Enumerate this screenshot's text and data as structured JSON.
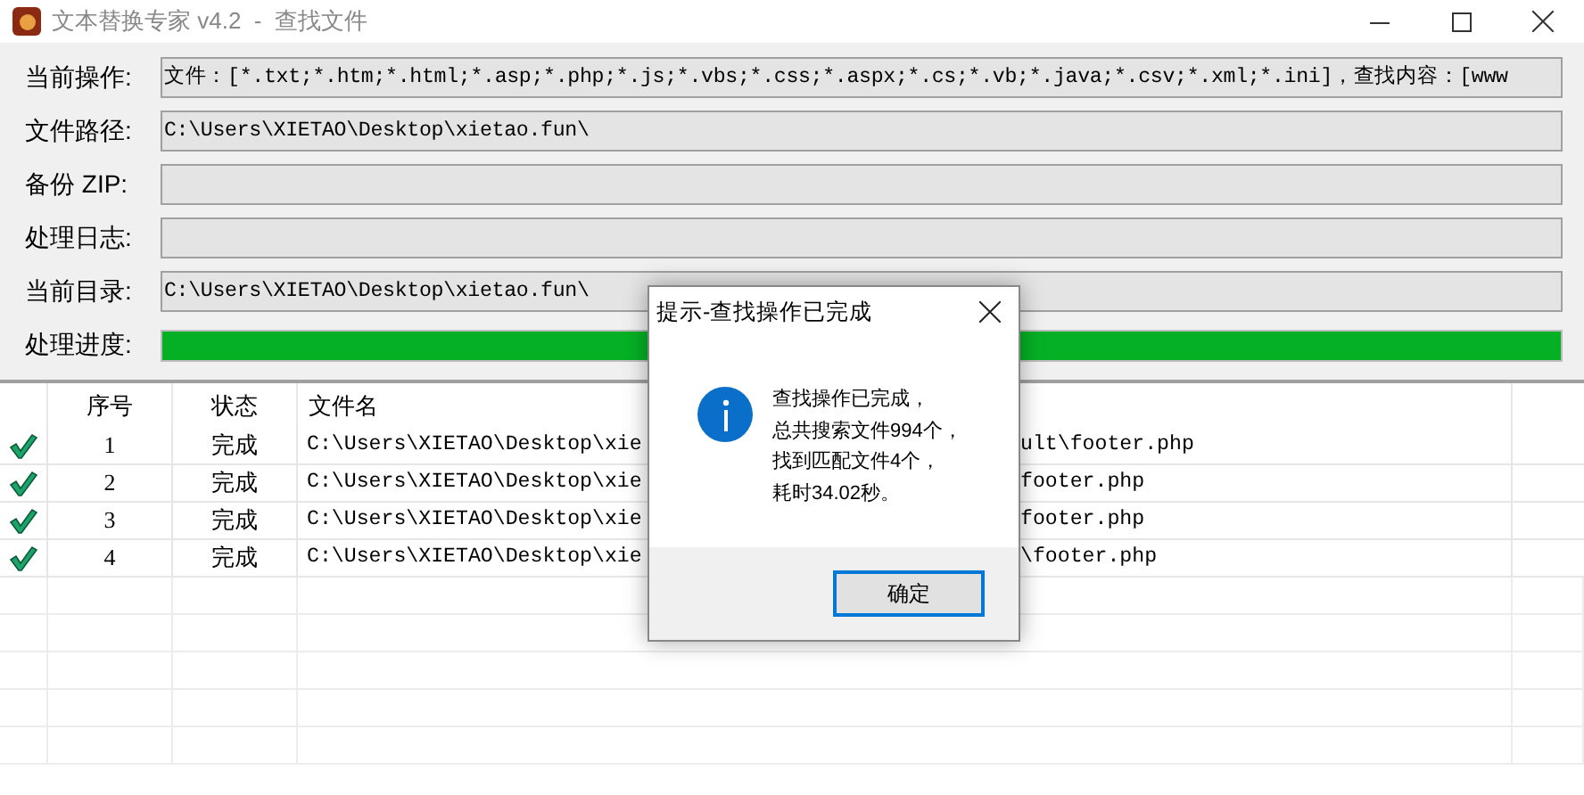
{
  "window": {
    "title": "文本替换专家 v4.2  -  查找文件"
  },
  "fields": [
    {
      "label": "当前操作:",
      "value": "文件：[*.txt;*.htm;*.html;*.asp;*.php;*.js;*.vbs;*.css;*.aspx;*.cs;*.vb;*.java;*.csv;*.xml;*.ini]，查找内容：[www"
    },
    {
      "label": "文件路径:",
      "value": "C:\\Users\\XIETAO\\Desktop\\xietao.fun\\"
    },
    {
      "label": "备份 ZIP:"
    },
    {
      "label": "处理日志:"
    },
    {
      "label": "当前目录:",
      "value": "C:\\Users\\XIETAO\\Desktop\\xietao.fun\\"
    }
  ],
  "progress": {
    "label": "处理进度:",
    "level": 1
  },
  "table": {
    "columns": [
      "序号",
      "状态",
      "文件名"
    ],
    "rows": [
      {
        "done": true,
        "index": "1",
        "status": "完成",
        "file_left": "C:\\Users\\XIETAO\\Desktop\\xie",
        "file_right": "ult\\footer.php"
      },
      {
        "done": true,
        "index": "2",
        "status": "完成",
        "file_left": "C:\\Users\\XIETAO\\Desktop\\xie",
        "file_right": "footer.php"
      },
      {
        "done": true,
        "index": "3",
        "status": "完成",
        "file_left": "C:\\Users\\XIETAO\\Desktop\\xie",
        "file_right": "footer.php"
      },
      {
        "done": true,
        "index": "4",
        "status": "完成",
        "file_left": "C:\\Users\\XIETAO\\Desktop\\xie",
        "file_right": "\\footer.php"
      }
    ]
  },
  "dialog": {
    "title": "提示-查找操作已完成",
    "lines": [
      "查找操作已完成，",
      "总共搜索文件994个，",
      "找到匹配文件4个，",
      "耗时34.02秒。"
    ],
    "button": "确定"
  }
}
